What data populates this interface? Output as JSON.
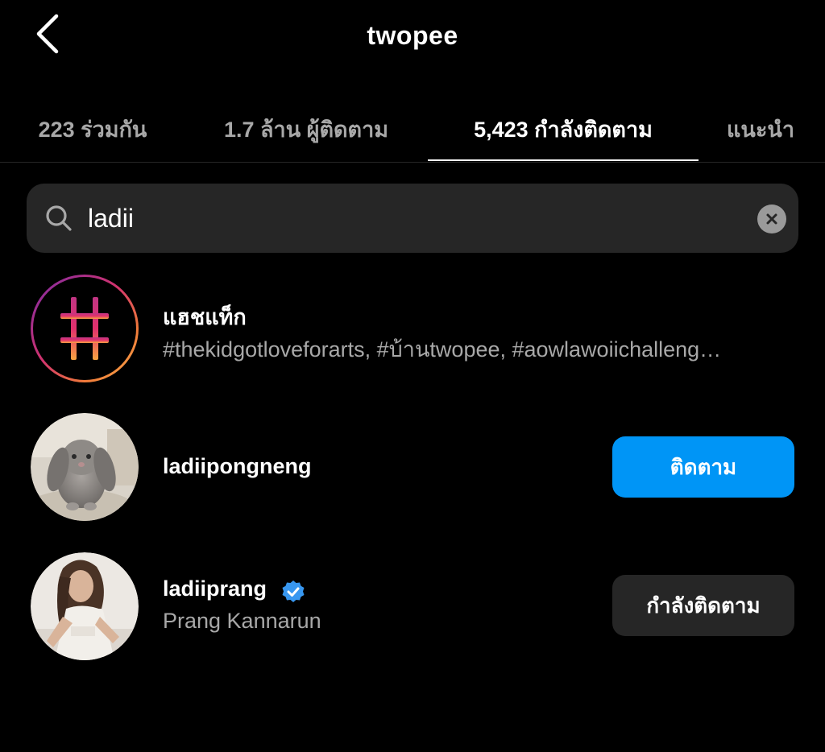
{
  "header": {
    "title": "twopee"
  },
  "tabs": [
    {
      "label": "223 ร่วมกัน",
      "active": false
    },
    {
      "label": "1.7 ล้าน ผู้ติดตาม",
      "active": false
    },
    {
      "label": "5,423 กำลังติดตาม",
      "active": true
    },
    {
      "label": "แนะนำ",
      "active": false
    }
  ],
  "search": {
    "value": "ladii",
    "placeholder": ""
  },
  "results": [
    {
      "type": "hashtag",
      "title": "แฮชแท็ก",
      "subtitle": "#thekidgotloveforarts, #บ้านtwopee, #aowlawoiichalleng…",
      "icon": "hashtag-icon"
    },
    {
      "type": "user",
      "username": "ladiipongneng",
      "button_label": "ติดตาม",
      "button_style": "primary"
    },
    {
      "type": "user",
      "username": "ladiiprang",
      "verified": true,
      "fullname": "Prang Kannarun",
      "button_label": "กำลังติดตาม",
      "button_style": "secondary"
    }
  ],
  "colors": {
    "background": "#000000",
    "follow_button": "#0095f6",
    "following_button": "#262626",
    "verified_badge": "#3897f0",
    "muted_text": "#a8a8a8"
  }
}
